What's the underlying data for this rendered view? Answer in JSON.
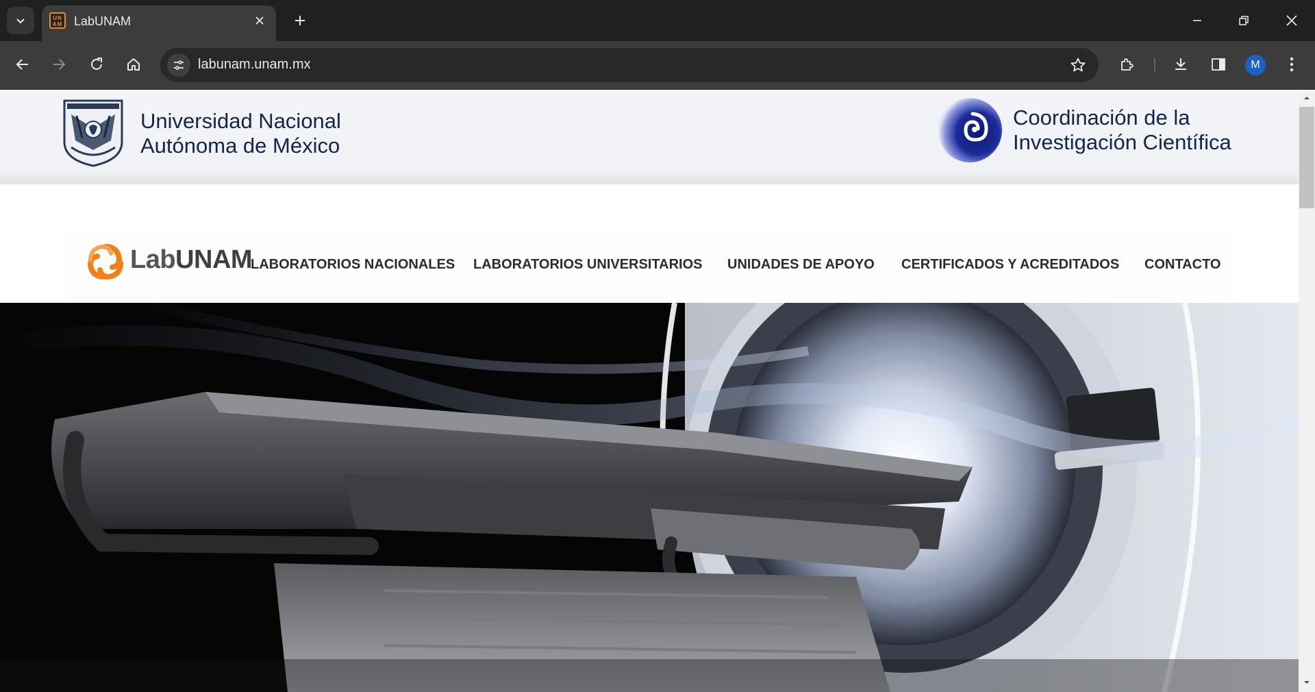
{
  "browser": {
    "tab_title": "LabUNAM",
    "favicon_text": "UN AM",
    "url": "labunam.unam.mx",
    "profile_initial": "M",
    "accent": "#1a63c4"
  },
  "header": {
    "unam_line1": "Universidad Nacional",
    "unam_line2": "Autónoma de México",
    "cic_line1": "Coordinación de la",
    "cic_line2": "Investigación Científica",
    "text_color": "#13254a"
  },
  "nav": {
    "logo_lab": "Lab",
    "logo_unam": "UNAM",
    "items": [
      {
        "label": "LABORATORIOS NACIONALES"
      },
      {
        "label": "LABORATORIOS UNIVERSITARIOS"
      },
      {
        "label": "UNIDADES DE APOYO"
      },
      {
        "label": "CERTIFICADOS Y ACREDITADOS"
      },
      {
        "label": "CONTACTO"
      }
    ],
    "logo_color": "#f07f1c"
  },
  "hero": {
    "icon": "mri-scanner-image"
  }
}
